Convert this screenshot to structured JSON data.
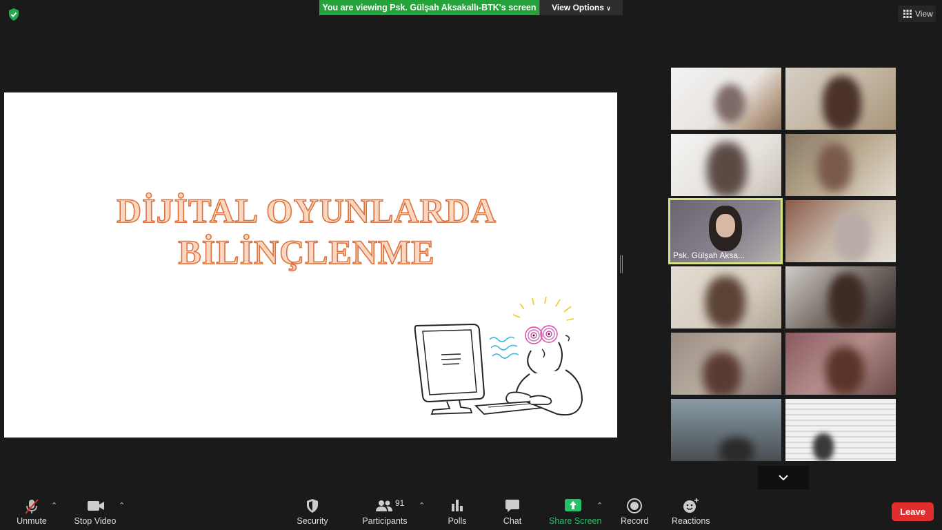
{
  "top": {
    "banner_text": "You are viewing Psk. Gülşah Aksakallı-BTK's screen",
    "view_options_label": "View Options",
    "view_label": "View"
  },
  "slide": {
    "title_line1": "DİJİTAL OYUNLARDA",
    "title_line2": "BİLİNÇLENME",
    "illustration": "person-at-computer-with-hypnotized-eyes"
  },
  "gallery": {
    "active_speaker_name": "Psk. Gülşah Aksa...",
    "tile_count_visible": 12
  },
  "toolbar": {
    "unmute_label": "Unmute",
    "stop_video_label": "Stop Video",
    "security_label": "Security",
    "participants_label": "Participants",
    "participants_count": "91",
    "polls_label": "Polls",
    "chat_label": "Chat",
    "share_screen_label": "Share Screen",
    "record_label": "Record",
    "reactions_label": "Reactions",
    "leave_label": "Leave"
  },
  "colors": {
    "banner_green": "#23a33a",
    "share_green": "#27c06a",
    "leave_red": "#e02d2d",
    "active_speaker_border": "#d8e27b",
    "slide_title_stroke": "#e0713a"
  }
}
